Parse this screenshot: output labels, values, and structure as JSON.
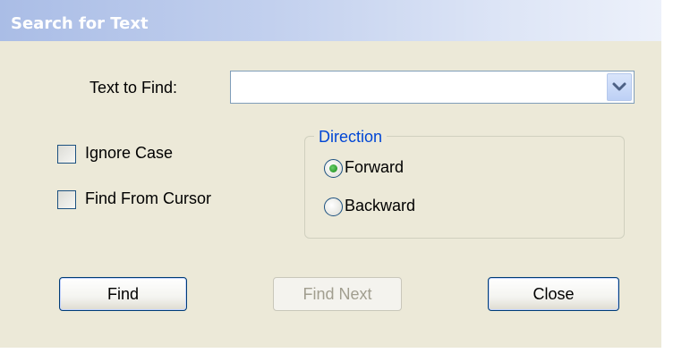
{
  "window": {
    "title": "Search for Text"
  },
  "search": {
    "label": "Text to Find:",
    "value": "",
    "placeholder": ""
  },
  "options": {
    "ignore_case": {
      "label": "Ignore Case",
      "checked": false
    },
    "find_from_cursor": {
      "label": "Find From Cursor",
      "checked": false
    }
  },
  "direction": {
    "legend": "Direction",
    "forward": {
      "label": "Forward",
      "selected": true
    },
    "backward": {
      "label": "Backward",
      "selected": false
    }
  },
  "buttons": {
    "find": "Find",
    "find_next": "Find Next",
    "close": "Close"
  },
  "colors": {
    "dialog_background": "#ece9d8",
    "title_text": "#ffffff",
    "groupbox_legend": "#0046d5",
    "radio_selected_dot": "#2e9c2e",
    "button_border": "#003c74",
    "disabled_text": "#a19e8f"
  },
  "icons": {
    "dropdown": "chevron-down-icon"
  }
}
